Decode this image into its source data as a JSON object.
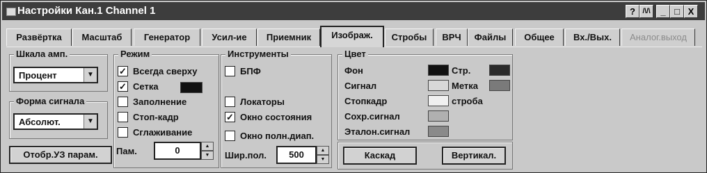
{
  "window": {
    "title": "Настройки Кан.1 Channel 1",
    "buttons": {
      "help": "?",
      "scope": "/\\/\\",
      "minimize": "_",
      "maximize": "□",
      "close": "X"
    }
  },
  "tabs": [
    "Развёртка",
    "Масштаб",
    "Генератор",
    "Усил-ие",
    "Приемник",
    "Изображ.",
    "Стробы",
    "ВРЧ",
    "Файлы",
    "Общее",
    "Вх./Вых.",
    "Аналог.выход"
  ],
  "active_tab": "Изображ.",
  "scale": {
    "title": "Шкала амп.",
    "value": "Процент"
  },
  "waveform": {
    "title": "Форма сигнала",
    "value": "Абсолют."
  },
  "show_params_button": "Отобр.УЗ парам.",
  "mode": {
    "title": "Режим",
    "items": [
      {
        "label": "Всегда сверху",
        "checked": true
      },
      {
        "label": "Сетка",
        "checked": true
      },
      {
        "label": "Заполнение",
        "checked": false
      },
      {
        "label": "Стоп-кадр",
        "checked": false
      },
      {
        "label": "Сглаживание",
        "checked": false
      }
    ],
    "grid_color": "#111111",
    "memory_label": "Пам.",
    "memory_value": "0"
  },
  "tools": {
    "title": "Инструменты",
    "items": [
      {
        "label": "БПФ",
        "checked": false
      },
      {
        "label": "Локаторы",
        "checked": false
      },
      {
        "label": "Окно состояния",
        "checked": true
      },
      {
        "label": "Окно полн.диап.",
        "checked": false
      }
    ],
    "width_label": "Шир.пол.",
    "width_value": "500"
  },
  "colors": {
    "title": "Цвет",
    "rows": [
      {
        "label": "Фон",
        "color": "#111111"
      },
      {
        "label": "Сигнал",
        "color": "#d8d8d8"
      },
      {
        "label": "Стопкадр",
        "color": "#f0f0f0"
      },
      {
        "label": "Сохр.сигнал",
        "color": "#b0b0b0"
      },
      {
        "label": "Эталон.сигнал",
        "color": "#8a8a8a"
      }
    ],
    "right": [
      {
        "label": "Стр.",
        "color": "#2a2a2a"
      },
      {
        "label": "Метка",
        "color": "#7a7a7a"
      },
      {
        "label": "строба",
        "color": ""
      }
    ]
  },
  "cascade_button": "Каскад",
  "vertical_button": "Вертикал."
}
